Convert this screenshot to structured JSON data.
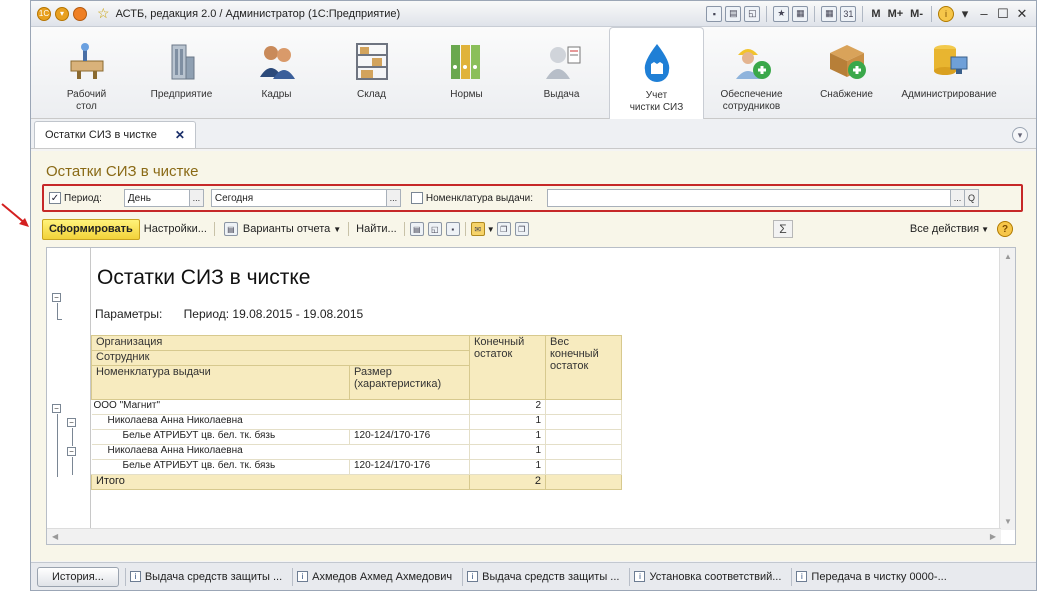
{
  "window": {
    "title": "АСТБ, редакция 2.0 / Администратор (1С:Предприятие)",
    "title_buttons": [
      "M",
      "M+",
      "M-"
    ]
  },
  "sections": [
    {
      "label": "Рабочий\nстол",
      "icon": "desk-icon"
    },
    {
      "label": "Предприятие",
      "icon": "building-icon"
    },
    {
      "label": "Кадры",
      "icon": "people-icon"
    },
    {
      "label": "Склад",
      "icon": "warehouse-icon"
    },
    {
      "label": "Нормы",
      "icon": "binders-icon"
    },
    {
      "label": "Выдача",
      "icon": "worker-icon"
    },
    {
      "label": "Учет\nчистки СИЗ",
      "icon": "water-drop-icon",
      "active": true
    },
    {
      "label": "Обеспечение\nсотрудников",
      "icon": "worker-add-icon"
    },
    {
      "label": "Снабжение",
      "icon": "box-add-icon"
    },
    {
      "label": "Администрирование",
      "icon": "database-icon"
    }
  ],
  "tab": {
    "label": "Остатки СИЗ в чистке",
    "close": "✕"
  },
  "form": {
    "title": "Остатки СИЗ в чистке",
    "period_label": "Период:",
    "period_type": "День",
    "period_value": "Сегодня",
    "nomenclature_label": "Номенклатура выдачи:",
    "nomenclature_value": "",
    "ellipsis": "...",
    "search_glyph": "Q"
  },
  "toolbar": {
    "generate": "Сформировать",
    "settings": "Настройки...",
    "variants": "Варианты отчета",
    "find": "Найти...",
    "sum": "Σ",
    "all_actions": "Все действия",
    "help": "?"
  },
  "report": {
    "title": "Остатки СИЗ в чистке",
    "params_label": "Параметры:",
    "params_value": "Период: 19.08.2015 - 19.08.2015",
    "headers": {
      "org": "Организация",
      "employee": "Сотрудник",
      "nomenclature": "Номенклатура выдачи",
      "size": "Размер\n(характеристика)",
      "balance": "Конечный\nостаток",
      "weight": "Вес\nконечный\nостаток"
    },
    "rows": [
      {
        "name": "ООО \"Магнит\"",
        "size": "",
        "balance": "2",
        "level": 0
      },
      {
        "name": "Николаева Анна Николаевна",
        "size": "",
        "balance": "1",
        "level": 1
      },
      {
        "name": "Белье АТРИБУТ цв. бел. тк. бязь",
        "size": "120-124/170-176",
        "balance": "1",
        "level": 2
      },
      {
        "name": "Николаева Анна Николаевна",
        "size": "",
        "balance": "1",
        "level": 1
      },
      {
        "name": "Белье АТРИБУТ цв. бел. тк. бязь",
        "size": "120-124/170-176",
        "balance": "1",
        "level": 2
      }
    ],
    "total_label": "Итого",
    "total_value": "2"
  },
  "taskbar": {
    "history": "История...",
    "items": [
      "Выдача средств защиты ...",
      "Ахмедов Ахмед Ахмедович",
      "Выдача средств защиты ...",
      "Установка соответствий...",
      "Передача в чистку 0000-..."
    ]
  }
}
